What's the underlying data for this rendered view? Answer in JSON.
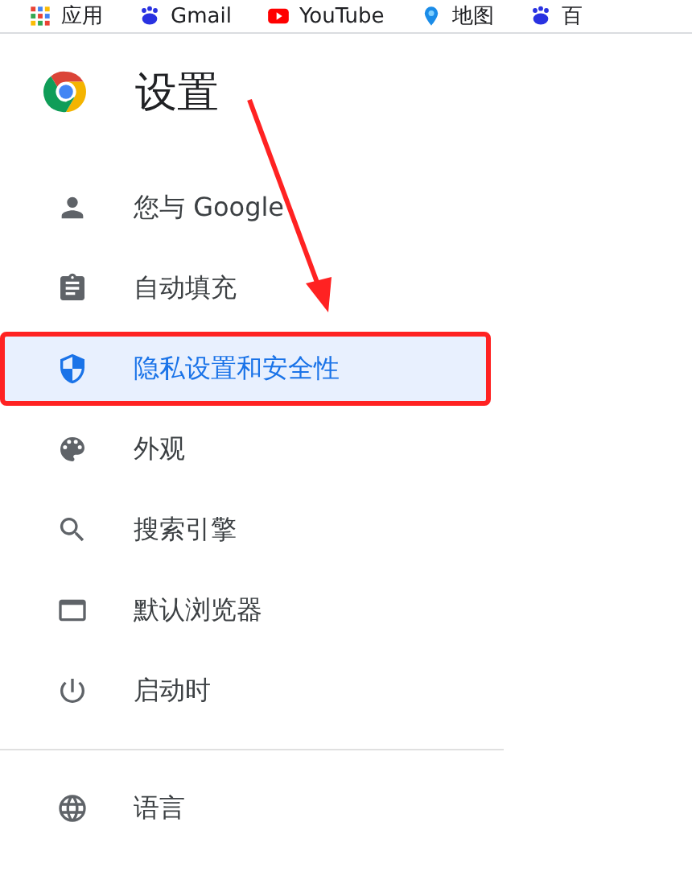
{
  "bookmarks_bar": [
    {
      "kind": "apps",
      "label": "应用"
    },
    {
      "kind": "paw",
      "label": "Gmail"
    },
    {
      "kind": "video",
      "label": "YouTube"
    },
    {
      "kind": "map",
      "label": "地图"
    },
    {
      "kind": "paw",
      "label": "百"
    }
  ],
  "header": {
    "title": "设置"
  },
  "sidebar": {
    "items": [
      {
        "kind": "person",
        "label": "您与 Google",
        "selected": false
      },
      {
        "kind": "clipboard",
        "label": "自动填充",
        "selected": false
      },
      {
        "kind": "shield",
        "label": "隐私设置和安全性",
        "selected": true
      },
      {
        "kind": "palette",
        "label": "外观",
        "selected": false
      },
      {
        "kind": "search",
        "label": "搜索引擎",
        "selected": false
      },
      {
        "kind": "browser",
        "label": "默认浏览器",
        "selected": false
      },
      {
        "kind": "power",
        "label": "启动时",
        "selected": false
      }
    ],
    "advanced_items": [
      {
        "kind": "globe",
        "label": "语言",
        "selected": false
      }
    ]
  }
}
